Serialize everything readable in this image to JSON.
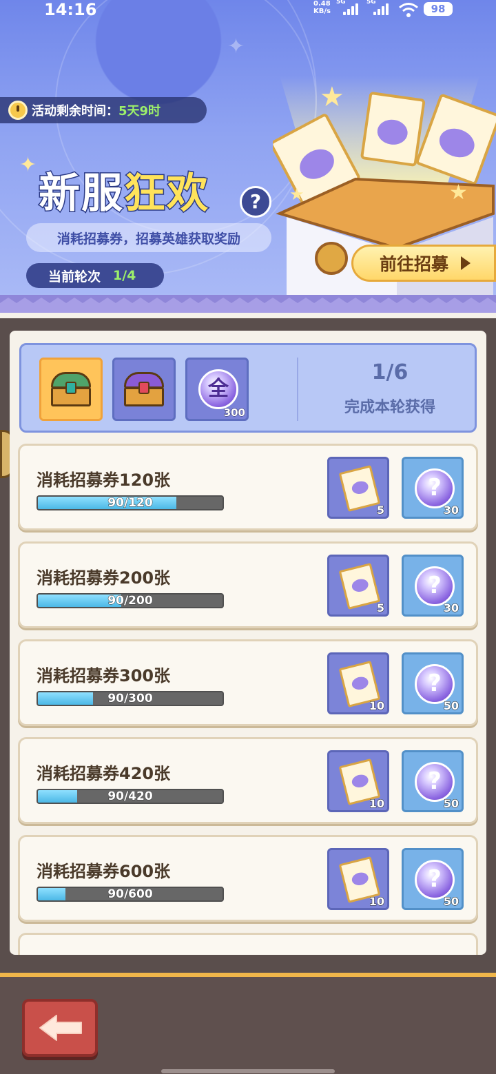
{
  "status_bar": {
    "time": "14:16",
    "net_speed_top": "0.48",
    "net_speed_bottom": "KB/s",
    "sim1_label": "5G",
    "sim2_label": "5G",
    "battery": "98"
  },
  "event": {
    "timer_label": "活动剩余时间：",
    "timer_value": "5天9时",
    "title_part1": "新服",
    "title_part2": "狂欢",
    "help_label": "?",
    "description": "消耗招募券，招募英雄获取奖励",
    "round_label": "当前轮次",
    "round_value": "1/4",
    "go_button_label": "前往招募"
  },
  "summary": {
    "slots": [
      {
        "icon": "chest-gold-icon"
      },
      {
        "icon": "chest-purple-icon"
      },
      {
        "icon": "orb-all-icon",
        "glyph": "全",
        "count": "300"
      }
    ],
    "progress": "1/6",
    "caption": "完成本轮获得"
  },
  "tasks": [
    {
      "title": "消耗招募券120张",
      "progress_text": "90/120",
      "fraction": 0.75,
      "ticket_count": "5",
      "orb_count": "30"
    },
    {
      "title": "消耗招募券200张",
      "progress_text": "90/200",
      "fraction": 0.45,
      "ticket_count": "5",
      "orb_count": "30"
    },
    {
      "title": "消耗招募券300张",
      "progress_text": "90/300",
      "fraction": 0.3,
      "ticket_count": "10",
      "orb_count": "50"
    },
    {
      "title": "消耗招募券420张",
      "progress_text": "90/420",
      "fraction": 0.214,
      "ticket_count": "10",
      "orb_count": "50"
    },
    {
      "title": "消耗招募券600张",
      "progress_text": "90/600",
      "fraction": 0.15,
      "ticket_count": "10",
      "orb_count": "50"
    }
  ],
  "reward_glyph": "?",
  "colors": {
    "accent_green": "#9df06a",
    "bar_fill": "#4cb8e6",
    "button_gold": "#ffd76a",
    "back_red": "#c9504a"
  }
}
